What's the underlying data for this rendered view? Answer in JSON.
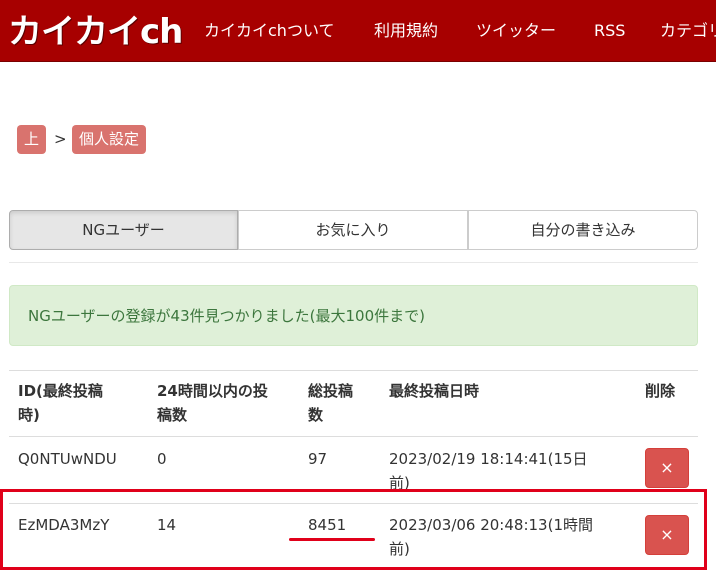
{
  "header": {
    "logo_text": "カイカイch",
    "nav": [
      "カイカイchついて",
      "利用規約",
      "ツイッター",
      "RSS",
      "カテゴリ"
    ]
  },
  "breadcrumb": {
    "home": "上",
    "separator": ">",
    "current": "個人設定"
  },
  "tabs": [
    "NGユーザー",
    "お気に入り",
    "自分の書き込み"
  ],
  "alert": {
    "message": "NGユーザーの登録が43件見つかりました(最大100件まで)"
  },
  "table": {
    "headers": {
      "id_line1": "ID(最終投稿",
      "id_line2": "時)",
      "posts24_line1": "24時間以内の投",
      "posts24_line2": "稿数",
      "total_line1": "総投稿",
      "total_line2": "数",
      "last_post": "最終投稿日時",
      "delete": "削除"
    },
    "rows": [
      {
        "id": "Q0NTUwNDU",
        "posts_24h": "0",
        "total": "97",
        "last_line1": "2023/02/19 18:14:41(15日",
        "last_line2": "前)",
        "delete_icon": "×"
      },
      {
        "id": "EzMDA3MzY",
        "posts_24h": "14",
        "total": "8451",
        "last_line1": "2023/03/06 20:48:13(1時間",
        "last_line2": "前)",
        "delete_icon": "×"
      }
    ]
  },
  "colors": {
    "header_bg": "#a70000",
    "crumb_bg": "#d9736e",
    "alert_bg": "#dff0d8",
    "alert_text": "#3c763d",
    "delete_bg": "#d9534f",
    "annotation": "#e0001a"
  }
}
